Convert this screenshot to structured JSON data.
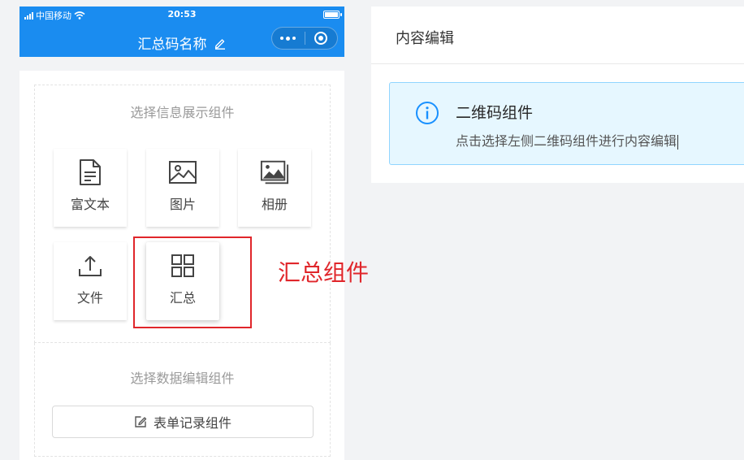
{
  "status_bar": {
    "carrier": "中国移动",
    "time": "20:53"
  },
  "nav": {
    "title": "汇总码名称"
  },
  "info_section": {
    "title": "选择信息展示组件",
    "components": [
      {
        "label": "富文本",
        "icon": "document-icon"
      },
      {
        "label": "图片",
        "icon": "image-icon"
      },
      {
        "label": "相册",
        "icon": "album-icon"
      },
      {
        "label": "文件",
        "icon": "upload-icon"
      },
      {
        "label": "汇总",
        "icon": "grid-icon"
      }
    ]
  },
  "data_section": {
    "title": "选择数据编辑组件",
    "form_button": "表单记录组件"
  },
  "annotation": {
    "text": "汇总组件",
    "color": "#e0262b"
  },
  "content_panel": {
    "title": "内容编辑",
    "alert": {
      "title": "二维码组件",
      "description": "点击选择左侧二维码组件进行内容编辑"
    }
  },
  "colors": {
    "primary": "#1a8cf0",
    "alert_bg": "#e6f7ff",
    "alert_border": "#91d5ff",
    "highlight": "#e0262b"
  }
}
